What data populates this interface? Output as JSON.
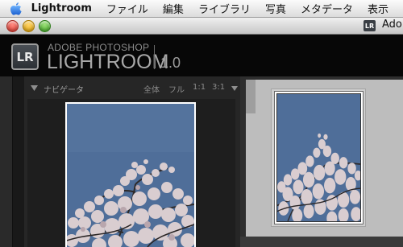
{
  "menubar": {
    "apple_icon": "apple-logo-icon",
    "app_name": "Lightroom",
    "items": [
      "ファイル",
      "編集",
      "ライブラリ",
      "写真",
      "メタデータ",
      "表示"
    ]
  },
  "window": {
    "title_icon_text": "LR",
    "title": "Ado"
  },
  "identity_plate": {
    "logo_text": "LR",
    "line1": "ADOBE PHOTOSHOP",
    "line2": "LIGHTROOM",
    "version": "1.0"
  },
  "navigator": {
    "title": "ナビゲータ",
    "zoom_options": [
      "全体",
      "フル",
      "1:1",
      "3:1"
    ]
  },
  "colors": {
    "sky": "#4f6e99",
    "panel": "#262626",
    "grid_bg": "#bdbdbd"
  }
}
